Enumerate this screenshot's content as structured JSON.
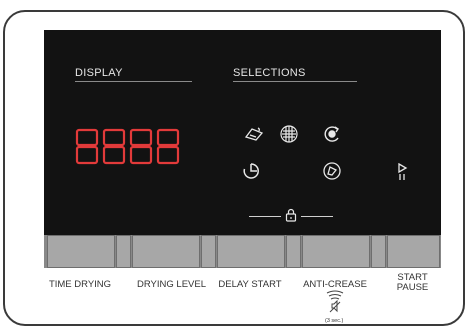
{
  "display": {
    "title": "DISPLAY",
    "digits": "8888"
  },
  "selections": {
    "title": "SELECTIONS",
    "icons": [
      "iron-dry-icon",
      "cupboard-dry-icon",
      "extra-dry-icon",
      "timer-icon",
      "mixed-load-icon"
    ]
  },
  "start_icon": "play-pause-icon",
  "lock_icon": "child-lock-icon",
  "buttons": {
    "time_drying": "TIME DRYING",
    "drying_level": "DRYING LEVEL",
    "delay_start": "DELAY START",
    "anti_crease": "ANTI-CREASE",
    "start_line1": "START",
    "start_line2": "PAUSE"
  },
  "anti_crease_hint": "(3 sec.)",
  "colors": {
    "panel": "#121212",
    "segment_red": "#e23a3a",
    "button": "#a7a7a7"
  }
}
